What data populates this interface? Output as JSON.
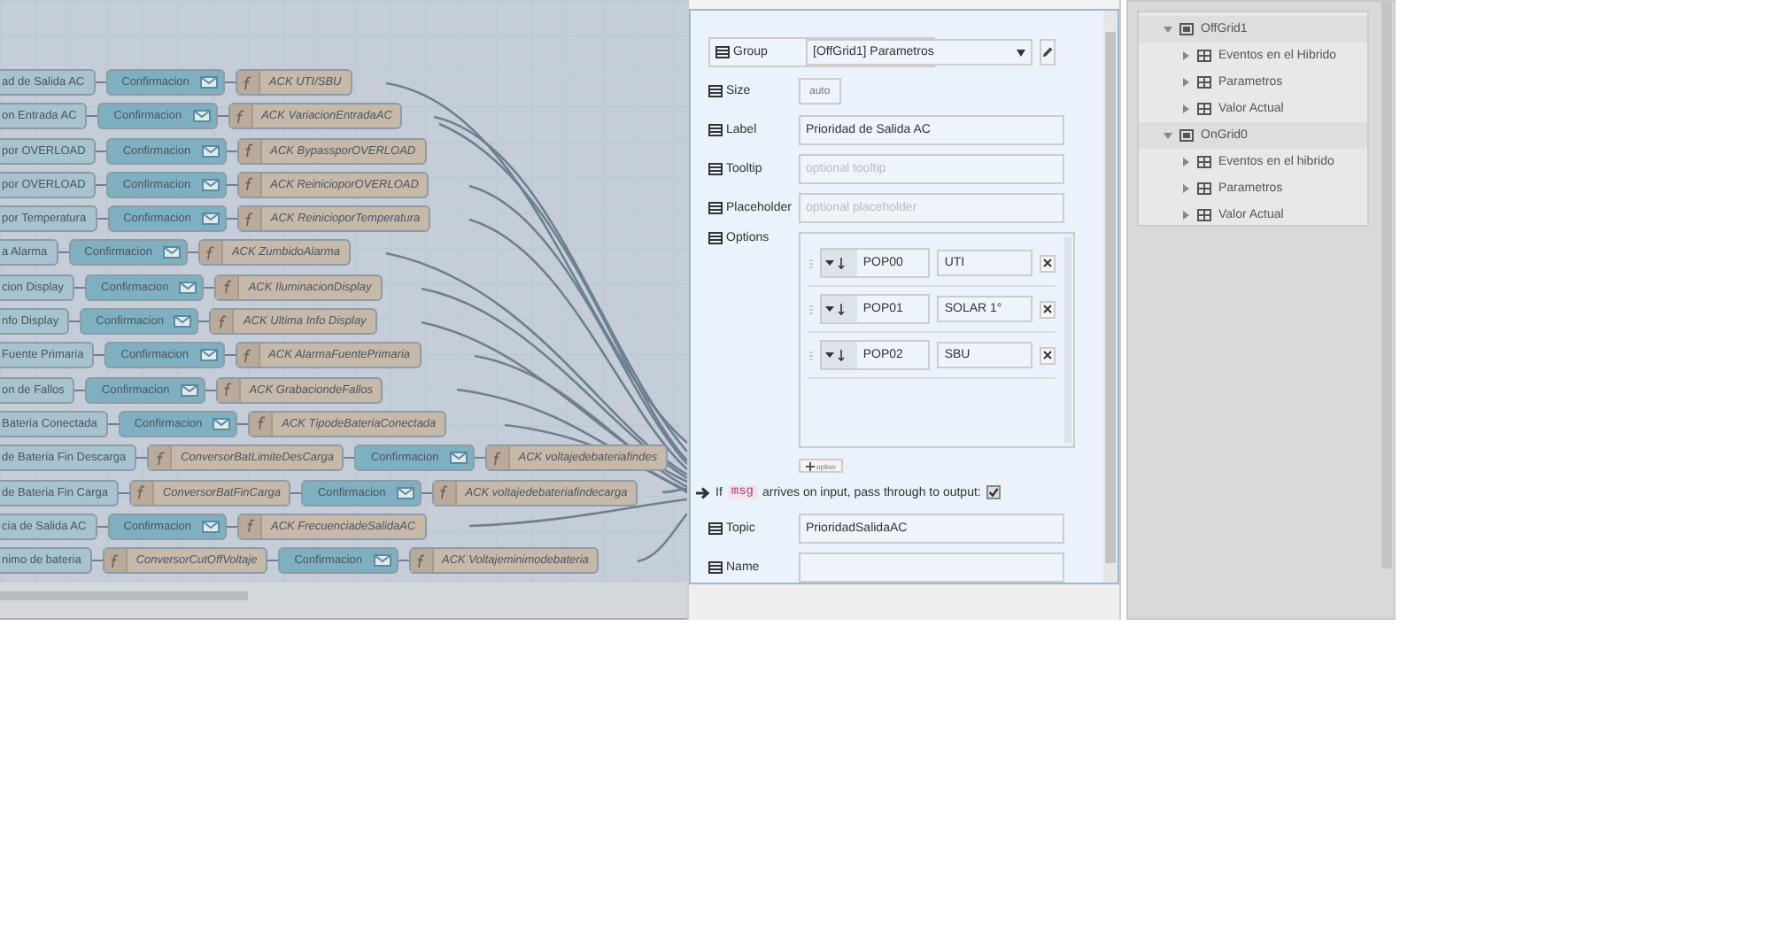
{
  "canvas": {
    "rows": [
      {
        "nodes": [
          {
            "kind": "ui",
            "label": "ad de Salida AC"
          },
          {
            "kind": "notify",
            "label": "Confirmacion"
          },
          {
            "kind": "function",
            "label": "ACK UTI/SBU"
          }
        ]
      },
      {
        "nodes": [
          {
            "kind": "ui",
            "label": "on Entrada AC"
          },
          {
            "kind": "notify",
            "label": "Confirmacion"
          },
          {
            "kind": "function",
            "label": "ACK VariacionEntradaAC"
          }
        ]
      },
      {
        "nodes": [
          {
            "kind": "ui",
            "label": "por OVERLOAD"
          },
          {
            "kind": "notify",
            "label": "Confirmacion"
          },
          {
            "kind": "function",
            "label": "ACK BypassporOVERLOAD"
          }
        ]
      },
      {
        "nodes": [
          {
            "kind": "ui",
            "label": "por OVERLOAD"
          },
          {
            "kind": "notify",
            "label": "Confirmacion"
          },
          {
            "kind": "function",
            "label": "ACK ReinicioporOVERLOAD"
          }
        ]
      },
      {
        "nodes": [
          {
            "kind": "ui",
            "label": "por Temperatura"
          },
          {
            "kind": "notify",
            "label": "Confirmacion"
          },
          {
            "kind": "function",
            "label": "ACK ReinicioporTemperatura"
          }
        ]
      },
      {
        "nodes": [
          {
            "kind": "ui",
            "label": "a Alarma"
          },
          {
            "kind": "notify",
            "label": "Confirmacion"
          },
          {
            "kind": "function",
            "label": "ACK ZumbidoAlarma"
          }
        ]
      },
      {
        "nodes": [
          {
            "kind": "ui",
            "label": "cion Display"
          },
          {
            "kind": "notify",
            "label": "Confirmacion"
          },
          {
            "kind": "function",
            "label": "ACK IluminacionDisplay"
          }
        ]
      },
      {
        "nodes": [
          {
            "kind": "ui",
            "label": "nfo Display"
          },
          {
            "kind": "notify",
            "label": "Confirmacion"
          },
          {
            "kind": "function",
            "label": "ACK Ultima Info Display"
          }
        ]
      },
      {
        "nodes": [
          {
            "kind": "ui",
            "label": "Fuente Primaria"
          },
          {
            "kind": "notify",
            "label": "Confirmacion"
          },
          {
            "kind": "function",
            "label": "ACK AlarmaFuentePrimaria"
          }
        ]
      },
      {
        "nodes": [
          {
            "kind": "ui",
            "label": "on de Fallos"
          },
          {
            "kind": "notify",
            "label": "Confirmacion"
          },
          {
            "kind": "function",
            "label": "ACK GrabaciondeFallos"
          }
        ]
      },
      {
        "nodes": [
          {
            "kind": "ui",
            "label": "Bateria Conectada"
          },
          {
            "kind": "notify",
            "label": "Confirmacion"
          },
          {
            "kind": "function",
            "label": "ACK TipodeBateriaConectada"
          }
        ]
      },
      {
        "nodes": [
          {
            "kind": "ui",
            "label": "de Bateria Fin Descarga"
          },
          {
            "kind": "function",
            "label": "ConversorBatLimiteDesCarga"
          },
          {
            "kind": "notify",
            "label": "Confirmacion"
          },
          {
            "kind": "function",
            "label": "ACK voltajedebateriafindes"
          }
        ]
      },
      {
        "nodes": [
          {
            "kind": "ui",
            "label": "de Bateria Fin Carga"
          },
          {
            "kind": "function",
            "label": "ConversorBatFinCarga"
          },
          {
            "kind": "notify",
            "label": "Confirmacion"
          },
          {
            "kind": "function",
            "label": "ACK voltajedebateriafindecarga"
          }
        ]
      },
      {
        "nodes": [
          {
            "kind": "ui",
            "label": "cia de Salida AC"
          },
          {
            "kind": "notify",
            "label": "Confirmacion"
          },
          {
            "kind": "function",
            "label": "ACK FrecuenciadeSalidaAC"
          }
        ]
      },
      {
        "nodes": [
          {
            "kind": "ui",
            "label": "nimo de bateria"
          },
          {
            "kind": "function",
            "label": "ConversorCutOffVoltaje"
          },
          {
            "kind": "notify",
            "label": "Confirmacion"
          },
          {
            "kind": "function",
            "label": "ACK Voltajeminimodebateria"
          }
        ]
      }
    ]
  },
  "editor": {
    "fields": [
      {
        "kind": "select",
        "label": "Group",
        "value": "[OffGrid1] Parametros"
      },
      {
        "kind": "size",
        "label": "Size",
        "value": "auto"
      },
      {
        "kind": "input",
        "label": "Label",
        "value": "Prioridad de Salida AC"
      },
      {
        "kind": "input",
        "label": "Tooltip",
        "placeholder": "optional tooltip"
      },
      {
        "kind": "input",
        "label": "Placeholder",
        "placeholder": "optional placeholder"
      },
      {
        "kind": "options",
        "label": "Options",
        "add_button": "option",
        "items": [
          {
            "value": "POP00",
            "label": "UTI"
          },
          {
            "value": "POP01",
            "label": "SOLAR 1°"
          },
          {
            "value": "POP02",
            "label": "SBU"
          }
        ]
      },
      {
        "kind": "passthrough",
        "prefix": "If",
        "code": "msg",
        "text": "arrives on input, pass through to output:",
        "checked": true
      },
      {
        "kind": "input",
        "label": "Topic",
        "value": "PrioridadSalidaAC"
      },
      {
        "kind": "input",
        "label": "Name"
      }
    ]
  },
  "sidebar": {
    "tree": [
      {
        "label": "OffGrid1",
        "expanded": true,
        "children": [
          {
            "label": "Eventos en el Hibrido",
            "expanded": false
          },
          {
            "label": "Parametros",
            "expanded": false
          },
          {
            "label": "Valor Actual",
            "expanded": false
          }
        ]
      },
      {
        "label": "OnGrid0",
        "expanded": true,
        "children": [
          {
            "label": "Eventos en el hibrido",
            "expanded": false
          },
          {
            "label": "Parametros",
            "expanded": false
          },
          {
            "label": "Valor Actual",
            "expanded": false
          }
        ]
      }
    ]
  }
}
